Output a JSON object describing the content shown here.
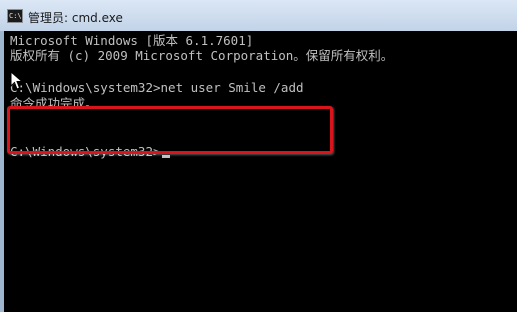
{
  "window": {
    "icon_text": "C:\\",
    "title": "管理员: cmd.exe"
  },
  "console": {
    "lines": [
      "Microsoft Windows [版本 6.1.7601]",
      "版权所有 (c) 2009 Microsoft Corporation。保留所有权利。",
      "C:\\Windows\\system32>net user Smile /add",
      "命令成功完成。",
      "C:\\Windows\\system32>"
    ]
  },
  "colors": {
    "console_background": "#000000",
    "console_text": "#c0c0c0",
    "highlight_border": "#d9141a",
    "titlebar": "#c9d8ea"
  },
  "icons": {
    "window_icon": "cmd-icon",
    "pointer": "mouse-pointer-icon"
  }
}
